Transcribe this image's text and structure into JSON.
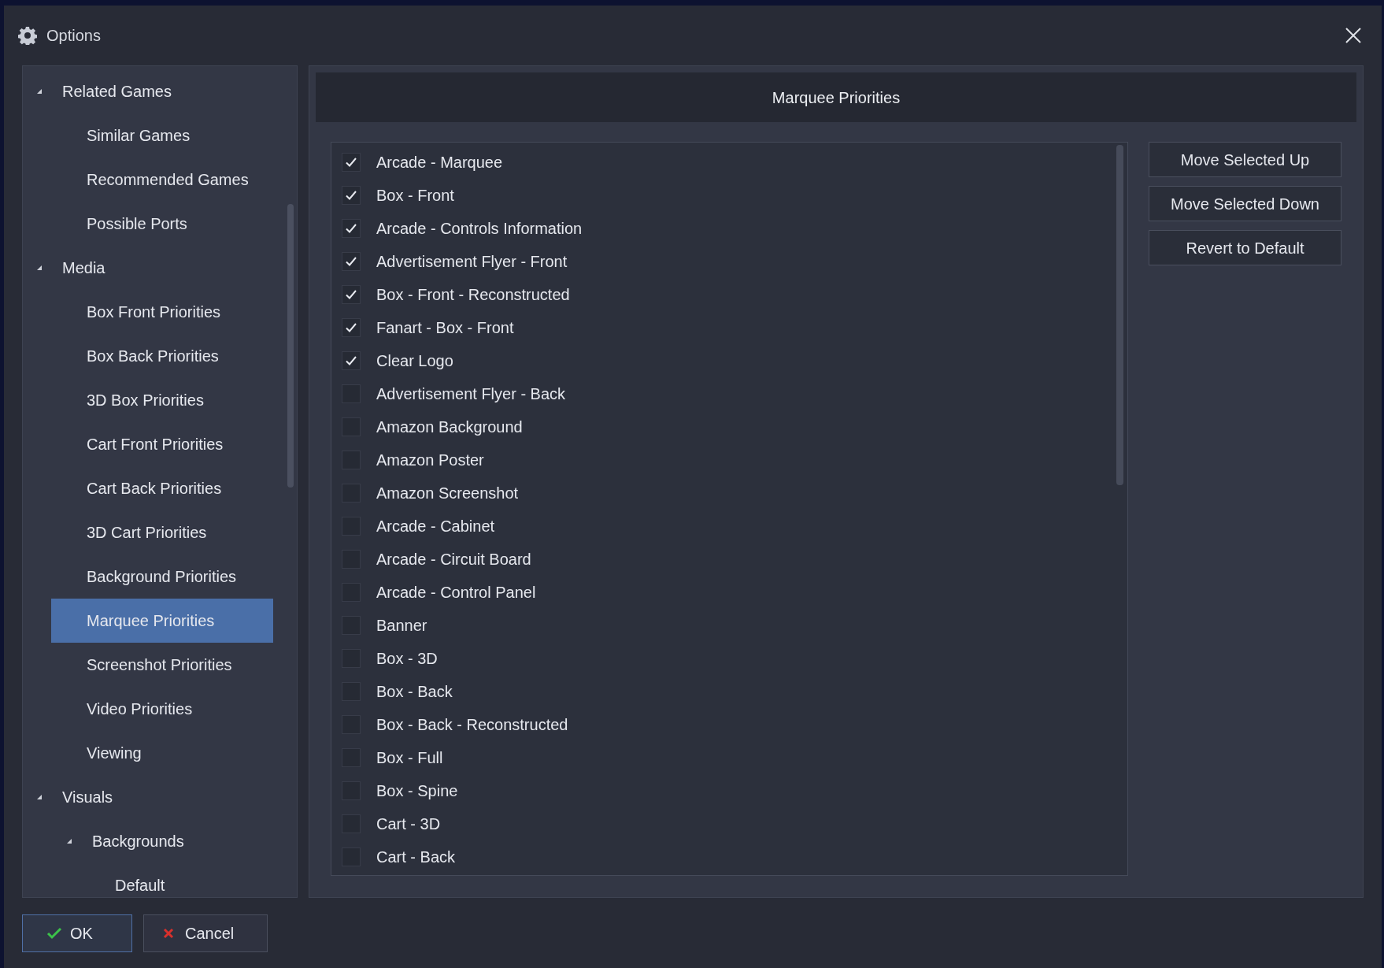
{
  "window": {
    "title": "Options"
  },
  "sidebar": {
    "items": [
      {
        "label": "Related Games",
        "expanded": true,
        "selected": false,
        "children": [
          {
            "label": "Similar Games",
            "selected": false
          },
          {
            "label": "Recommended Games",
            "selected": false
          },
          {
            "label": "Possible Ports",
            "selected": false
          }
        ]
      },
      {
        "label": "Media",
        "expanded": true,
        "selected": false,
        "children": [
          {
            "label": "Box Front Priorities",
            "selected": false
          },
          {
            "label": "Box Back Priorities",
            "selected": false
          },
          {
            "label": "3D Box Priorities",
            "selected": false
          },
          {
            "label": "Cart Front Priorities",
            "selected": false
          },
          {
            "label": "Cart Back Priorities",
            "selected": false
          },
          {
            "label": "3D Cart Priorities",
            "selected": false
          },
          {
            "label": "Background Priorities",
            "selected": false
          },
          {
            "label": "Marquee Priorities",
            "selected": true
          },
          {
            "label": "Screenshot Priorities",
            "selected": false
          },
          {
            "label": "Video Priorities",
            "selected": false
          },
          {
            "label": "Viewing",
            "selected": false
          }
        ]
      },
      {
        "label": "Visuals",
        "expanded": true,
        "selected": false,
        "children": [
          {
            "label": "Backgrounds",
            "expanded": true,
            "selected": false,
            "children": [
              {
                "label": "Default",
                "selected": false
              }
            ]
          }
        ]
      }
    ]
  },
  "panel": {
    "title": "Marquee Priorities",
    "items": [
      {
        "label": "Arcade - Marquee",
        "checked": true
      },
      {
        "label": "Box - Front",
        "checked": true
      },
      {
        "label": "Arcade - Controls Information",
        "checked": true
      },
      {
        "label": "Advertisement Flyer - Front",
        "checked": true
      },
      {
        "label": "Box - Front - Reconstructed",
        "checked": true
      },
      {
        "label": "Fanart - Box - Front",
        "checked": true
      },
      {
        "label": "Clear Logo",
        "checked": true
      },
      {
        "label": "Advertisement Flyer - Back",
        "checked": false
      },
      {
        "label": "Amazon Background",
        "checked": false
      },
      {
        "label": "Amazon Poster",
        "checked": false
      },
      {
        "label": "Amazon Screenshot",
        "checked": false
      },
      {
        "label": "Arcade - Cabinet",
        "checked": false
      },
      {
        "label": "Arcade - Circuit Board",
        "checked": false
      },
      {
        "label": "Arcade - Control Panel",
        "checked": false
      },
      {
        "label": "Banner",
        "checked": false
      },
      {
        "label": "Box - 3D",
        "checked": false
      },
      {
        "label": "Box - Back",
        "checked": false
      },
      {
        "label": "Box - Back - Reconstructed",
        "checked": false
      },
      {
        "label": "Box - Full",
        "checked": false
      },
      {
        "label": "Box - Spine",
        "checked": false
      },
      {
        "label": "Cart - 3D",
        "checked": false
      },
      {
        "label": "Cart - Back",
        "checked": false
      }
    ],
    "buttons": [
      "Move Selected Up",
      "Move Selected Down",
      "Revert to Default"
    ]
  },
  "footer": {
    "ok": "OK",
    "cancel": "Cancel"
  }
}
